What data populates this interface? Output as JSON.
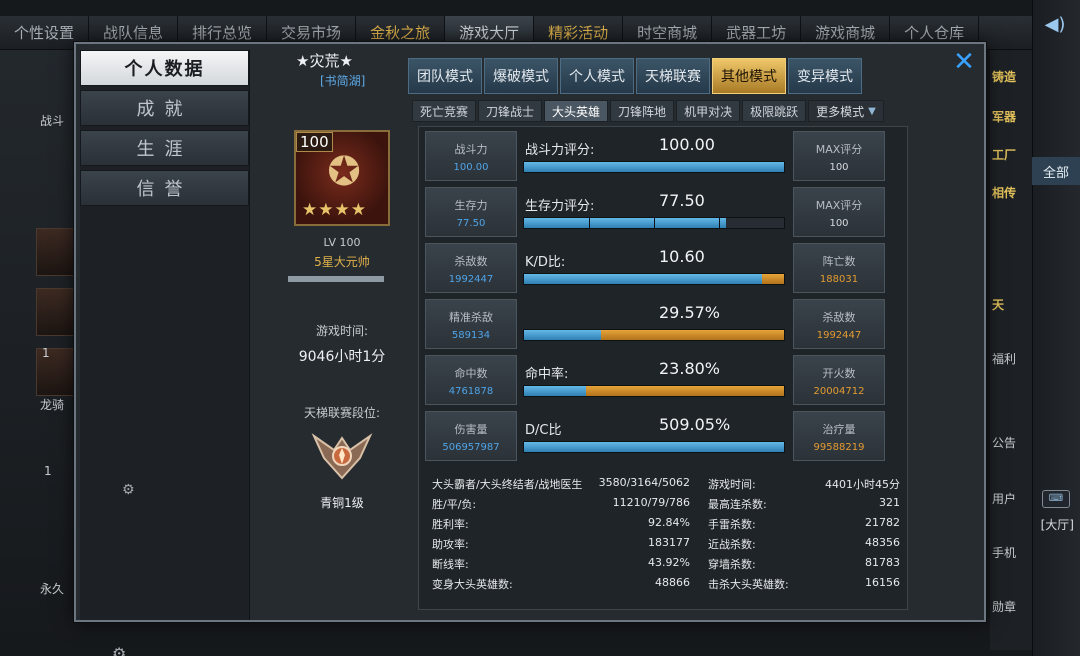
{
  "top_nav": {
    "items": [
      {
        "label": "个性设置",
        "style": "normal"
      },
      {
        "label": "战队信息",
        "style": "normal"
      },
      {
        "label": "排行总览",
        "style": "normal"
      },
      {
        "label": "交易市场",
        "style": "normal"
      },
      {
        "label": "金秋之旅",
        "style": "gold"
      },
      {
        "label": "游戏大厅",
        "style": "active"
      },
      {
        "label": "精彩活动",
        "style": "gold"
      },
      {
        "label": "时空商城",
        "style": "normal"
      },
      {
        "label": "武器工坊",
        "style": "normal"
      },
      {
        "label": "游戏商城",
        "style": "normal"
      },
      {
        "label": "个人仓库",
        "style": "normal"
      }
    ]
  },
  "right_sidebar": {
    "speaker_icon": "speaker-icon",
    "all_label": "全部",
    "keyboard_icon": "keyboard-icon",
    "hall_label": "[大厅]"
  },
  "background": {
    "left_labels": [
      "战斗",
      "龙骑",
      "永久"
    ],
    "left_numbers": [
      "1",
      "1"
    ],
    "right_labels": [
      "铸造",
      "军器",
      "工厂",
      "相传",
      "天",
      "福利",
      "公告",
      "用户",
      "手机",
      "勋章"
    ]
  },
  "dialog": {
    "close_icon": "close-icon",
    "left_menu": [
      {
        "label": "个人数据",
        "active": true
      },
      {
        "label": "成就",
        "active": false
      },
      {
        "label": "生涯",
        "active": false
      },
      {
        "label": "信誉",
        "active": false
      }
    ],
    "profile": {
      "name": "★灾荒★",
      "clan": "[书简湖]",
      "badge_level": "100",
      "badge_stars": "★★★★",
      "lv": "LV 100",
      "title": "5星大元帅",
      "exp_progress": 1.0,
      "playtime_label": "游戏时间:",
      "playtime_value": "9046小时1分",
      "ladder_label": "天梯联赛段位:",
      "ladder_rank": "青铜1级"
    },
    "mode_tabs": [
      {
        "label": "团队模式",
        "active": false
      },
      {
        "label": "爆破模式",
        "active": false
      },
      {
        "label": "个人模式",
        "active": false
      },
      {
        "label": "天梯联赛",
        "active": false
      },
      {
        "label": "其他模式",
        "active": true
      },
      {
        "label": "变异模式",
        "active": false
      }
    ],
    "sub_tabs": [
      {
        "label": "死亡竞赛",
        "active": false
      },
      {
        "label": "刀锋战士",
        "active": false
      },
      {
        "label": "大头英雄",
        "active": true
      },
      {
        "label": "刀锋阵地",
        "active": false
      },
      {
        "label": "机甲对决",
        "active": false
      },
      {
        "label": "极限跳跃",
        "active": false
      }
    ],
    "more_modes": "更多模式",
    "stats": {
      "rows": [
        {
          "left_label": "战斗力",
          "left_value": "100.00",
          "left_color": "blue",
          "bar_label": "战斗力评分:",
          "bar_value": "100.00",
          "blue": 1.0,
          "orange": 0.0,
          "segments": 1,
          "right_label": "MAX评分",
          "right_value": "100",
          "right_color": "white"
        },
        {
          "left_label": "生存力",
          "left_value": "77.50",
          "left_color": "blue",
          "bar_label": "生存力评分:",
          "bar_value": "77.50",
          "blue": 0.775,
          "orange": 0.0,
          "segments": 4,
          "right_label": "MAX评分",
          "right_value": "100",
          "right_color": "white"
        },
        {
          "left_label": "杀敌数",
          "left_value": "1992447",
          "left_color": "blue",
          "bar_label": "K/D比:",
          "bar_value": "10.60",
          "blue": 0.914,
          "orange": 0.086,
          "segments": 1,
          "right_label": "阵亡数",
          "right_value": "188031",
          "right_color": "orange"
        },
        {
          "left_label": "精准杀敌",
          "left_value": "589134",
          "left_color": "blue",
          "bar_label": "",
          "bar_value": "29.57%",
          "blue": 0.2957,
          "orange": 0.7043,
          "segments": 1,
          "right_label": "杀敌数",
          "right_value": "1992447",
          "right_color": "orange"
        },
        {
          "left_label": "命中数",
          "left_value": "4761878",
          "left_color": "blue",
          "bar_label": "命中率:",
          "bar_value": "23.80%",
          "blue": 0.238,
          "orange": 0.762,
          "segments": 1,
          "right_label": "开火数",
          "right_value": "20004712",
          "right_color": "orange"
        },
        {
          "left_label": "伤害量",
          "left_value": "506957987",
          "left_color": "blue",
          "bar_label": "D/C比",
          "bar_value": "509.05%",
          "blue": 1.0,
          "orange": 0.0,
          "segments": 1,
          "right_label": "治疗量",
          "right_value": "99588219",
          "right_color": "orange"
        }
      ],
      "details_left": [
        {
          "label": "大头霸者/大头终结者/战地医生",
          "value": "3580/3164/5062"
        },
        {
          "label": "胜/平/负:",
          "value": "11210/79/786"
        },
        {
          "label": "胜利率:",
          "value": "92.84%"
        },
        {
          "label": "助攻率:",
          "value": "183177"
        },
        {
          "label": "断线率:",
          "value": "43.92%"
        },
        {
          "label": "变身大头英雄数:",
          "value": "48866"
        }
      ],
      "details_right": [
        {
          "label": "游戏时间:",
          "value": "4401小时45分"
        },
        {
          "label": "最高连杀数:",
          "value": "321"
        },
        {
          "label": "手雷杀数:",
          "value": "21782"
        },
        {
          "label": "近战杀数:",
          "value": "48356"
        },
        {
          "label": "穿墙杀数:",
          "value": "81783"
        },
        {
          "label": "击杀大头英雄数:",
          "value": "16156"
        }
      ]
    }
  }
}
